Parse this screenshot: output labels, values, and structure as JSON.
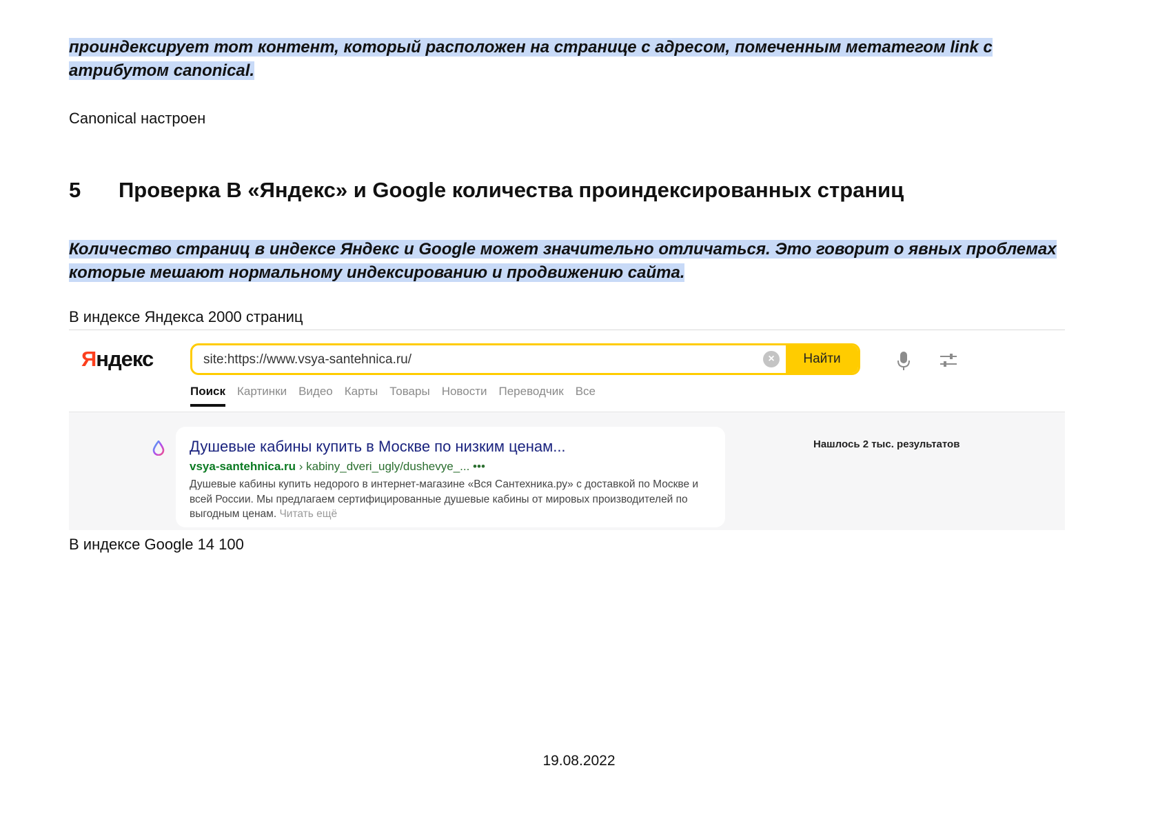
{
  "doc": {
    "para1": "проиндексирует тот контент, который расположен на странице с адресом, помеченным метатегом link с атрибутом canonical.",
    "para2": "Canonical настроен",
    "section_number": "5",
    "section_title": "Проверка В «Яндекс» и Google количества проиндексированных страниц",
    "para3": "Количество страниц в индексе Яндекс и Google может значительно отличаться. Это говорит о явных проблемах которые мешают нормальному индексированию и продвижению сайта.",
    "para4": "В индексе Яндекса 2000 страниц",
    "para5": "В индексе Google 14 100",
    "footer_date": "19.08.2022",
    "highlight_color": "#c8daf7"
  },
  "yandex": {
    "logo_first": "Я",
    "logo_rest": "ндекс",
    "search_value": "site:https://www.vsya-santehnica.ru/",
    "clear_symbol": "×",
    "find_label": "Найти",
    "tabs": [
      "Поиск",
      "Картинки",
      "Видео",
      "Карты",
      "Товары",
      "Новости",
      "Переводчик",
      "Все"
    ],
    "result": {
      "title": "Душевые кабины купить в Москве по низким ценам...",
      "domain": "vsya-santehnica.ru",
      "path": " › kabiny_dveri_ugly/dushevye_...  •••",
      "snippet": "Душевые кабины купить недорого в интернет-магазине «Вся Сантехника.ру» с доставкой по Москве и всей России. Мы предлагаем сертифицированные душевые кабины от мировых производителей по выгодным ценам.",
      "more": "Читать ещё"
    },
    "found_text": "Нашлось 2 тыс. результатов",
    "accent_color": "#ffcc00",
    "logo_color": "#fc3f1d",
    "icons": [
      "microphone-icon",
      "settings-sliders-icon",
      "clear-icon",
      "favicon-drop-icon"
    ]
  }
}
